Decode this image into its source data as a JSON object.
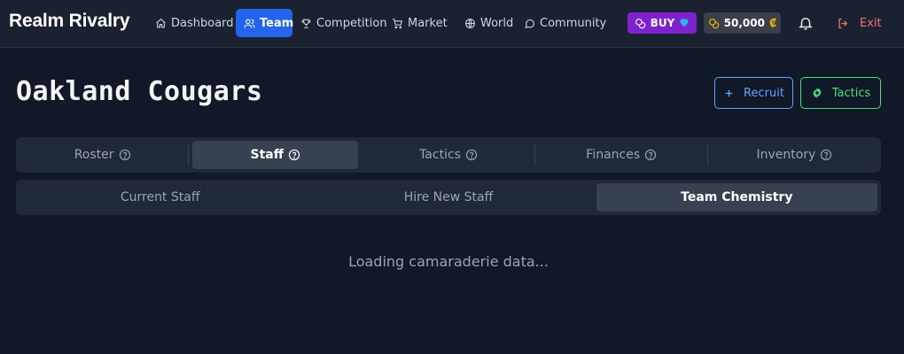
{
  "header": {
    "brand": "Realm Rivalry",
    "nav": [
      {
        "label": "Dashboard",
        "icon": "home-icon"
      },
      {
        "label": "Team",
        "icon": "users-icon",
        "active": true
      },
      {
        "label": "Competition",
        "icon": "trophy-icon"
      },
      {
        "label": "Market",
        "icon": "cart-icon"
      },
      {
        "label": "World",
        "icon": "globe-icon"
      },
      {
        "label": "Community",
        "icon": "chat-bubble-icon"
      }
    ],
    "buy_label": "BUY",
    "coins": "50,000",
    "currency_symbol": "₡",
    "exit_label": "Exit"
  },
  "team": {
    "name": "Oakland Cougars",
    "recruit_label": "Recruit",
    "tactics_label": "Tactics"
  },
  "main_tabs": [
    {
      "label": "Roster"
    },
    {
      "label": "Staff",
      "active": true
    },
    {
      "label": "Tactics"
    },
    {
      "label": "Finances"
    },
    {
      "label": "Inventory"
    }
  ],
  "sub_tabs": [
    {
      "label": "Current Staff"
    },
    {
      "label": "Hire New Staff"
    },
    {
      "label": "Team Chemistry",
      "active": true
    }
  ],
  "content": {
    "loading_text": "Loading camaraderie data..."
  },
  "colors": {
    "background": "#111827",
    "nav_active": "#2563eb",
    "buy": "#7e22ce",
    "recruit": "#60a5fa",
    "tactics": "#4ade80",
    "exit": "#f87171",
    "coin": "#eab308"
  }
}
